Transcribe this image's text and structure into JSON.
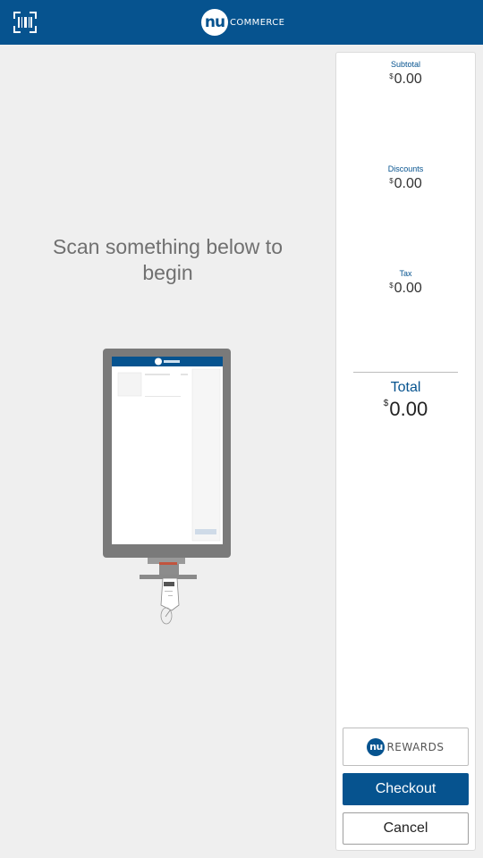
{
  "header": {
    "brand_logo_text": "nu",
    "brand_text": "COMMERCE",
    "scan_icon": "barcode-scan-icon",
    "bar_color": "#06538f"
  },
  "main": {
    "prompt": "Scan something below to begin",
    "illustration": "kiosk-scanner-illustration"
  },
  "summary": {
    "subtotal": {
      "label": "Subtotal",
      "currency": "$",
      "value": "0.00"
    },
    "discounts": {
      "label": "Discounts",
      "currency": "$",
      "value": "0.00"
    },
    "tax": {
      "label": "Tax",
      "currency": "$",
      "value": "0.00"
    },
    "total": {
      "label": "Total",
      "currency": "$",
      "value": "0.00"
    }
  },
  "actions": {
    "rewards_logo": "nu",
    "rewards_text": "REWARDS",
    "checkout_label": "Checkout",
    "cancel_label": "Cancel"
  }
}
